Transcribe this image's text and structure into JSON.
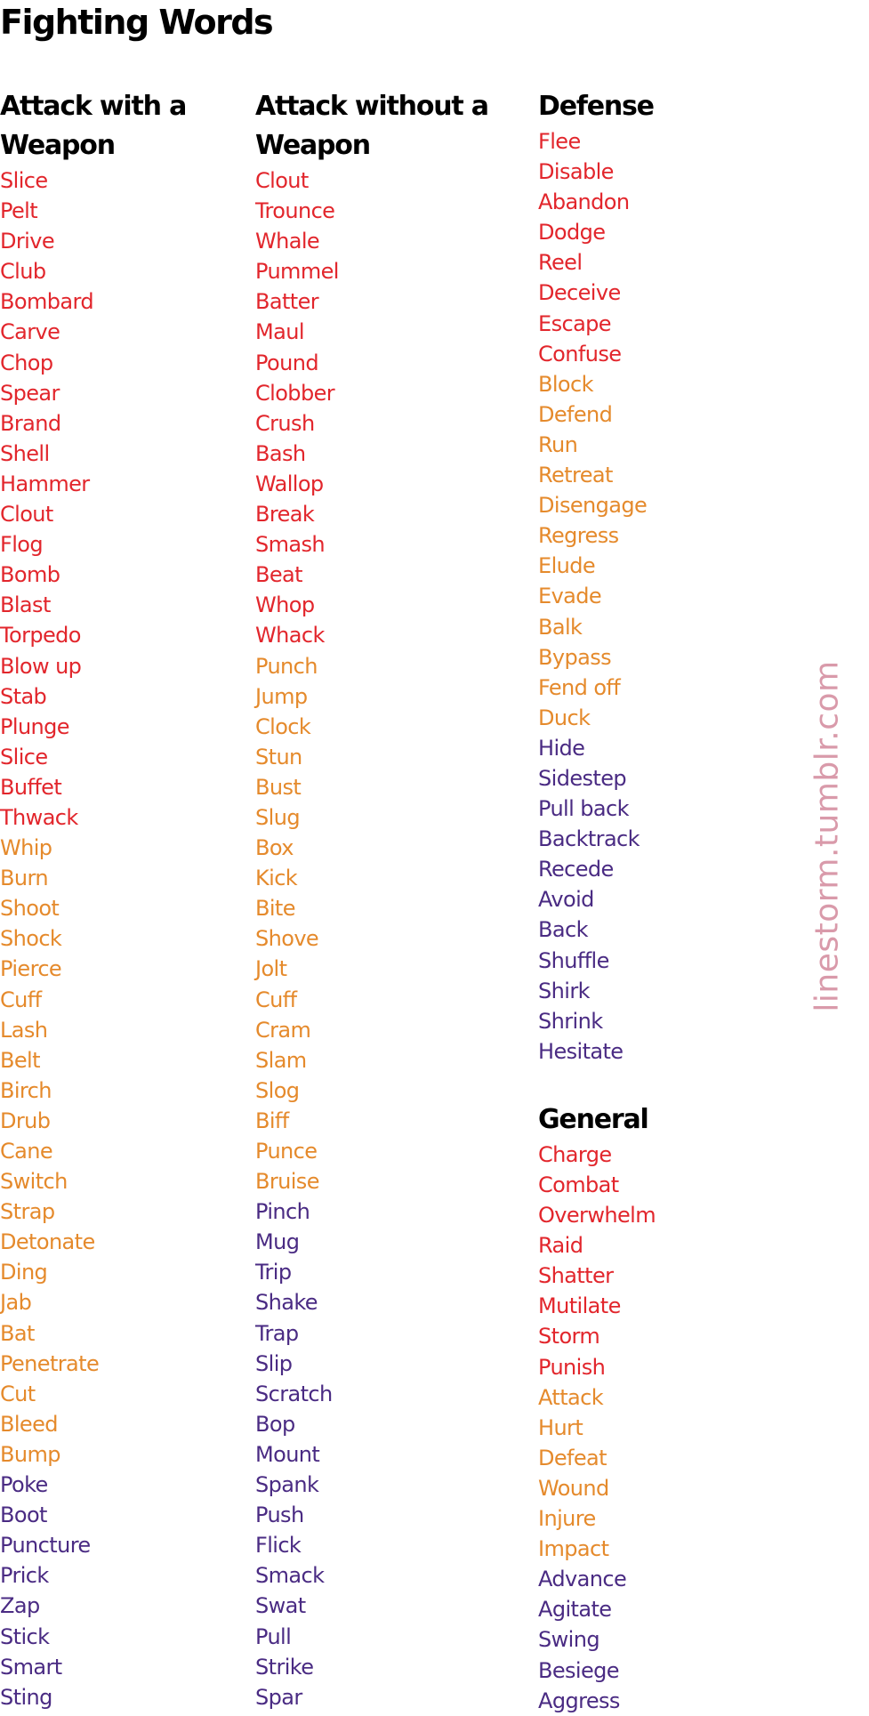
{
  "title": "Fighting Words",
  "watermark": "linestorm.tumblr.com",
  "colors": {
    "red": "#e2262c",
    "orange": "#e58a2c",
    "purple": "#4a2b83",
    "heading": "#000000",
    "watermark": "#d99aaa"
  },
  "columns": [
    {
      "heading": "Attack with a Weapon",
      "sections": [
        {
          "heading": "Attack with a Weapon",
          "words": [
            {
              "text": "Slice",
              "tone": "red"
            },
            {
              "text": "Pelt",
              "tone": "red"
            },
            {
              "text": "Drive",
              "tone": "red"
            },
            {
              "text": "Club",
              "tone": "red"
            },
            {
              "text": "Bombard",
              "tone": "red"
            },
            {
              "text": "Carve",
              "tone": "red"
            },
            {
              "text": "Chop",
              "tone": "red"
            },
            {
              "text": "Spear",
              "tone": "red"
            },
            {
              "text": "Brand",
              "tone": "red"
            },
            {
              "text": "Shell",
              "tone": "red"
            },
            {
              "text": "Hammer",
              "tone": "red"
            },
            {
              "text": "Clout",
              "tone": "red"
            },
            {
              "text": "Flog",
              "tone": "red"
            },
            {
              "text": "Bomb",
              "tone": "red"
            },
            {
              "text": "Blast",
              "tone": "red"
            },
            {
              "text": "Torpedo",
              "tone": "red"
            },
            {
              "text": "Blow up",
              "tone": "red"
            },
            {
              "text": "Stab",
              "tone": "red"
            },
            {
              "text": "Plunge",
              "tone": "red"
            },
            {
              "text": "Slice",
              "tone": "red"
            },
            {
              "text": "Buffet",
              "tone": "red"
            },
            {
              "text": "Thwack",
              "tone": "red"
            },
            {
              "text": "Whip",
              "tone": "orange"
            },
            {
              "text": "Burn",
              "tone": "orange"
            },
            {
              "text": "Shoot",
              "tone": "orange"
            },
            {
              "text": "Shock",
              "tone": "orange"
            },
            {
              "text": "Pierce",
              "tone": "orange"
            },
            {
              "text": "Cuff",
              "tone": "orange"
            },
            {
              "text": "Lash",
              "tone": "orange"
            },
            {
              "text": "Belt",
              "tone": "orange"
            },
            {
              "text": "Birch",
              "tone": "orange"
            },
            {
              "text": "Drub",
              "tone": "orange"
            },
            {
              "text": "Cane",
              "tone": "orange"
            },
            {
              "text": "Switch",
              "tone": "orange"
            },
            {
              "text": "Strap",
              "tone": "orange"
            },
            {
              "text": "Detonate",
              "tone": "orange"
            },
            {
              "text": "Ding",
              "tone": "orange"
            },
            {
              "text": "Jab",
              "tone": "orange"
            },
            {
              "text": "Bat",
              "tone": "orange"
            },
            {
              "text": "Penetrate",
              "tone": "orange"
            },
            {
              "text": "Cut",
              "tone": "orange"
            },
            {
              "text": "Bleed",
              "tone": "orange"
            },
            {
              "text": "Bump",
              "tone": "orange"
            },
            {
              "text": "Poke",
              "tone": "purple"
            },
            {
              "text": "Boot",
              "tone": "purple"
            },
            {
              "text": "Puncture",
              "tone": "purple"
            },
            {
              "text": "Prick",
              "tone": "purple"
            },
            {
              "text": "Zap",
              "tone": "purple"
            },
            {
              "text": "Stick",
              "tone": "purple"
            },
            {
              "text": "Smart",
              "tone": "purple"
            },
            {
              "text": "Sting",
              "tone": "purple"
            }
          ]
        }
      ]
    },
    {
      "heading": "Attack without a Weapon",
      "sections": [
        {
          "heading": "Attack without a Weapon",
          "words": [
            {
              "text": "Clout",
              "tone": "red"
            },
            {
              "text": "Trounce",
              "tone": "red"
            },
            {
              "text": "Whale",
              "tone": "red"
            },
            {
              "text": "Pummel",
              "tone": "red"
            },
            {
              "text": "Batter",
              "tone": "red"
            },
            {
              "text": "Maul",
              "tone": "red"
            },
            {
              "text": "Pound",
              "tone": "red"
            },
            {
              "text": "Clobber",
              "tone": "red"
            },
            {
              "text": "Crush",
              "tone": "red"
            },
            {
              "text": "Bash",
              "tone": "red"
            },
            {
              "text": "Wallop",
              "tone": "red"
            },
            {
              "text": "Break",
              "tone": "red"
            },
            {
              "text": "Smash",
              "tone": "red"
            },
            {
              "text": "Beat",
              "tone": "red"
            },
            {
              "text": "Whop",
              "tone": "red"
            },
            {
              "text": "Whack",
              "tone": "red"
            },
            {
              "text": "Punch",
              "tone": "orange"
            },
            {
              "text": "Jump",
              "tone": "orange"
            },
            {
              "text": "Clock",
              "tone": "orange"
            },
            {
              "text": "Stun",
              "tone": "orange"
            },
            {
              "text": "Bust",
              "tone": "orange"
            },
            {
              "text": "Slug",
              "tone": "orange"
            },
            {
              "text": "Box",
              "tone": "orange"
            },
            {
              "text": "Kick",
              "tone": "orange"
            },
            {
              "text": "Bite",
              "tone": "orange"
            },
            {
              "text": "Shove",
              "tone": "orange"
            },
            {
              "text": "Jolt",
              "tone": "orange"
            },
            {
              "text": "Cuff",
              "tone": "orange"
            },
            {
              "text": "Cram",
              "tone": "orange"
            },
            {
              "text": "Slam",
              "tone": "orange"
            },
            {
              "text": "Slog",
              "tone": "orange"
            },
            {
              "text": "Biff",
              "tone": "orange"
            },
            {
              "text": "Punce",
              "tone": "orange"
            },
            {
              "text": "Bruise",
              "tone": "orange"
            },
            {
              "text": "Pinch",
              "tone": "purple"
            },
            {
              "text": "Mug",
              "tone": "purple"
            },
            {
              "text": "Trip",
              "tone": "purple"
            },
            {
              "text": "Shake",
              "tone": "purple"
            },
            {
              "text": "Trap",
              "tone": "purple"
            },
            {
              "text": "Slip",
              "tone": "purple"
            },
            {
              "text": "Scratch",
              "tone": "purple"
            },
            {
              "text": "Bop",
              "tone": "purple"
            },
            {
              "text": "Mount",
              "tone": "purple"
            },
            {
              "text": "Spank",
              "tone": "purple"
            },
            {
              "text": "Push",
              "tone": "purple"
            },
            {
              "text": "Flick",
              "tone": "purple"
            },
            {
              "text": "Smack",
              "tone": "purple"
            },
            {
              "text": "Swat",
              "tone": "purple"
            },
            {
              "text": "Pull",
              "tone": "purple"
            },
            {
              "text": "Strike",
              "tone": "purple"
            },
            {
              "text": "Spar",
              "tone": "purple"
            }
          ]
        }
      ]
    },
    {
      "heading": "Defense",
      "sections": [
        {
          "heading": "Defense",
          "words": [
            {
              "text": "Flee",
              "tone": "red"
            },
            {
              "text": "Disable",
              "tone": "red"
            },
            {
              "text": "Abandon",
              "tone": "red"
            },
            {
              "text": "Dodge",
              "tone": "red"
            },
            {
              "text": "Reel",
              "tone": "red"
            },
            {
              "text": "Deceive",
              "tone": "red"
            },
            {
              "text": "Escape",
              "tone": "red"
            },
            {
              "text": "Confuse",
              "tone": "red"
            },
            {
              "text": "Block",
              "tone": "orange"
            },
            {
              "text": "Defend",
              "tone": "orange"
            },
            {
              "text": "Run",
              "tone": "orange"
            },
            {
              "text": "Retreat",
              "tone": "orange"
            },
            {
              "text": "Disengage",
              "tone": "orange"
            },
            {
              "text": "Regress",
              "tone": "orange"
            },
            {
              "text": "Elude",
              "tone": "orange"
            },
            {
              "text": "Evade",
              "tone": "orange"
            },
            {
              "text": "Balk",
              "tone": "orange"
            },
            {
              "text": "Bypass",
              "tone": "orange"
            },
            {
              "text": "Fend off",
              "tone": "orange"
            },
            {
              "text": "Duck",
              "tone": "orange"
            },
            {
              "text": "Hide",
              "tone": "purple"
            },
            {
              "text": "Sidestep",
              "tone": "purple"
            },
            {
              "text": "Pull back",
              "tone": "purple"
            },
            {
              "text": "Backtrack",
              "tone": "purple"
            },
            {
              "text": "Recede",
              "tone": "purple"
            },
            {
              "text": "Avoid",
              "tone": "purple"
            },
            {
              "text": "Back",
              "tone": "purple"
            },
            {
              "text": "Shuffle",
              "tone": "purple"
            },
            {
              "text": "Shirk",
              "tone": "purple"
            },
            {
              "text": "Shrink",
              "tone": "purple"
            },
            {
              "text": "Hesitate",
              "tone": "purple"
            }
          ]
        },
        {
          "heading": "General",
          "words": [
            {
              "text": "Charge",
              "tone": "red"
            },
            {
              "text": "Combat",
              "tone": "red"
            },
            {
              "text": "Overwhelm",
              "tone": "red"
            },
            {
              "text": "Raid",
              "tone": "red"
            },
            {
              "text": "Shatter",
              "tone": "red"
            },
            {
              "text": "Mutilate",
              "tone": "red"
            },
            {
              "text": "Storm",
              "tone": "red"
            },
            {
              "text": "Punish",
              "tone": "red"
            },
            {
              "text": "Attack",
              "tone": "orange"
            },
            {
              "text": "Hurt",
              "tone": "orange"
            },
            {
              "text": "Defeat",
              "tone": "orange"
            },
            {
              "text": "Wound",
              "tone": "orange"
            },
            {
              "text": "Injure",
              "tone": "orange"
            },
            {
              "text": "Impact",
              "tone": "orange"
            },
            {
              "text": "Advance",
              "tone": "purple"
            },
            {
              "text": "Agitate",
              "tone": "purple"
            },
            {
              "text": "Swing",
              "tone": "purple"
            },
            {
              "text": "Besiege",
              "tone": "purple"
            },
            {
              "text": "Aggress",
              "tone": "purple"
            }
          ]
        }
      ]
    }
  ]
}
